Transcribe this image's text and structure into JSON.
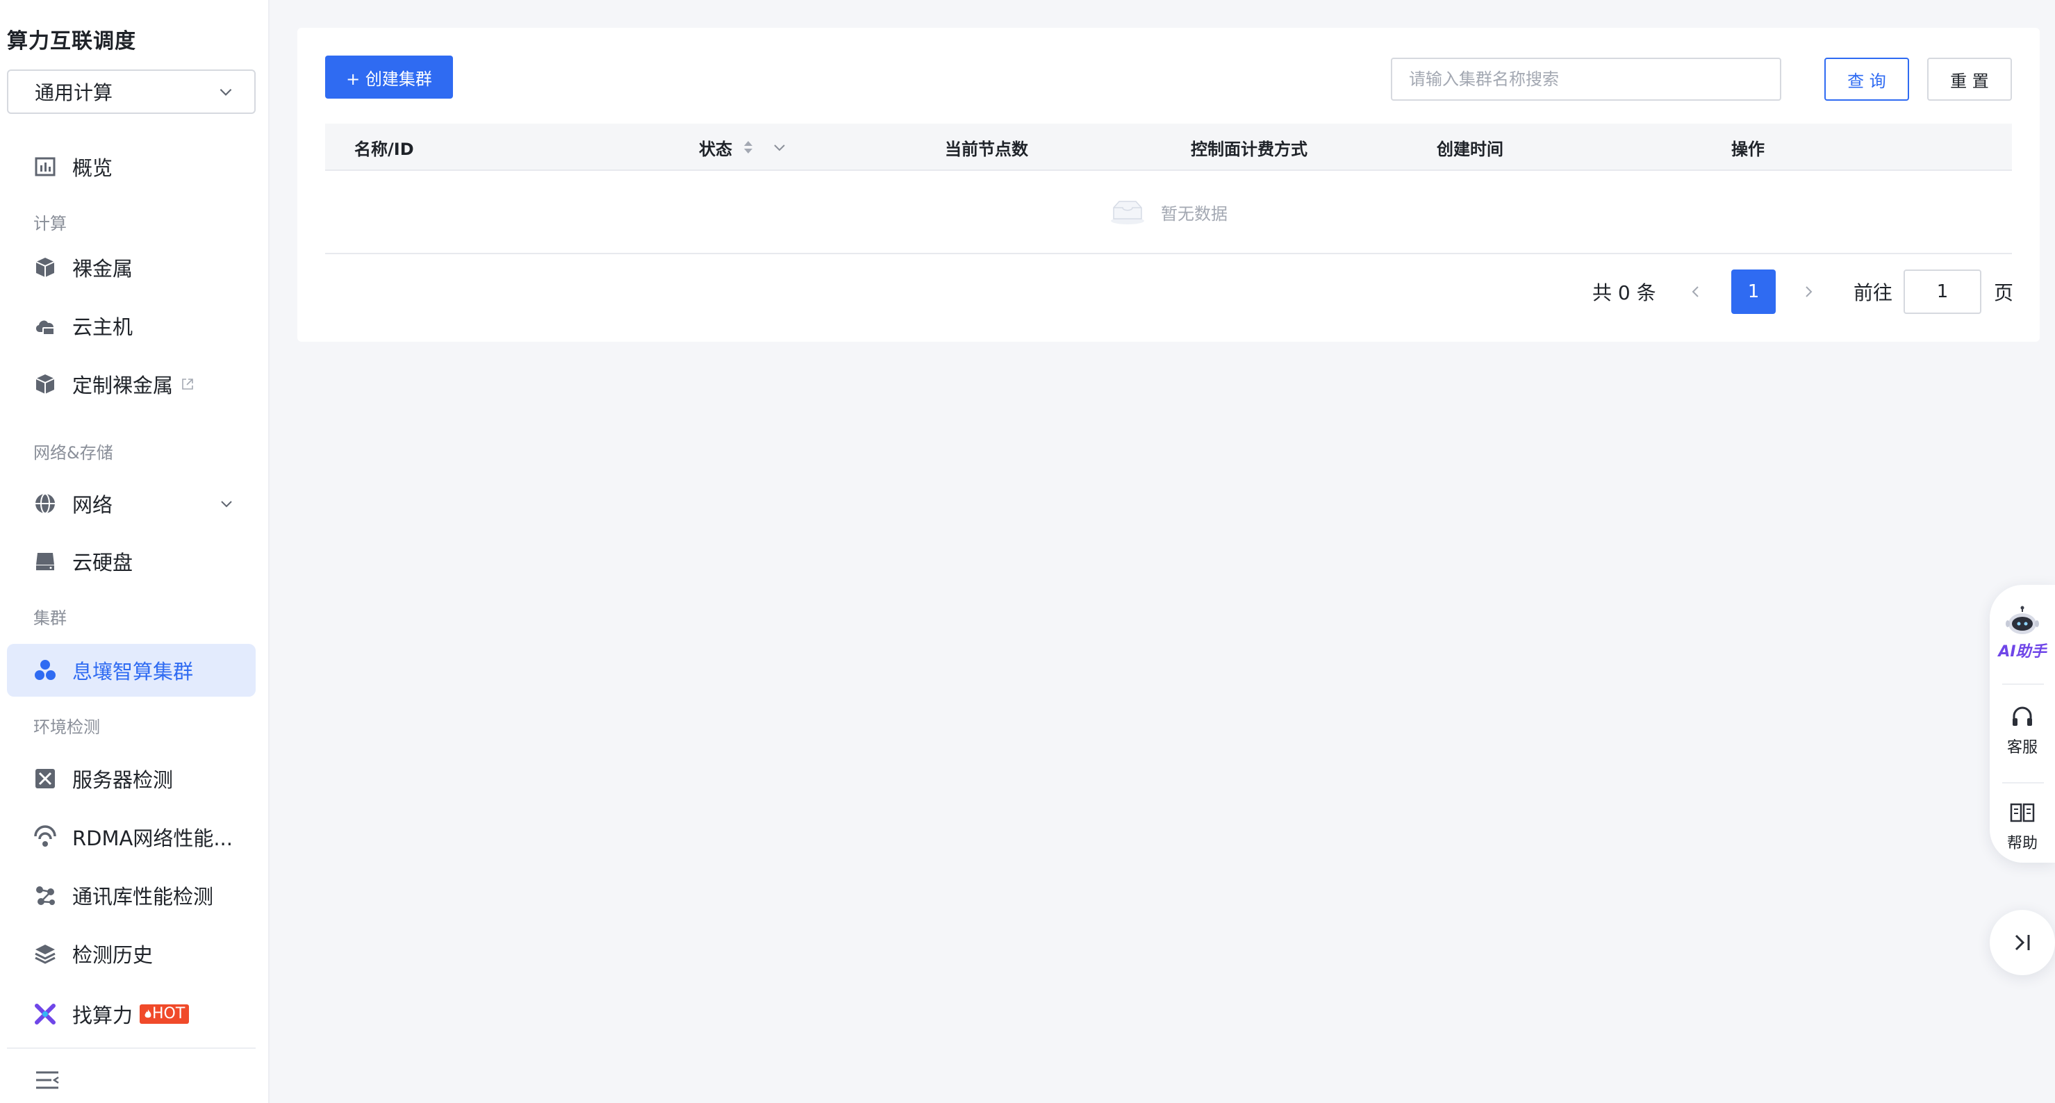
{
  "app": {
    "title": "算力互联调度"
  },
  "product_select": {
    "value": "通用计算"
  },
  "sidebar": {
    "overview": "概览",
    "group_compute": "计算",
    "bare_metal": "裸金属",
    "cloud_host": "云主机",
    "custom_bare_metal": "定制裸金属",
    "group_network_storage": "网络&存储",
    "network": "网络",
    "cloud_disk": "云硬盘",
    "group_cluster": "集群",
    "xirang_cluster": "息壤智算集群",
    "group_env_check": "环境检测",
    "server_check": "服务器检测",
    "rdma_check": "RDMA网络性能...",
    "comm_lib_check": "通讯库性能检测",
    "check_history": "检测历史",
    "find_compute": "找算力",
    "hot_badge": "HOT"
  },
  "toolbar": {
    "create_label": "+ 创建集群",
    "search_placeholder": "请输入集群名称搜索",
    "query_label": "查 询",
    "reset_label": "重 置"
  },
  "table": {
    "columns": [
      "名称/ID",
      "状态",
      "当前节点数",
      "控制面计费方式",
      "创建时间",
      "操作"
    ],
    "empty_text": "暂无数据"
  },
  "pagination": {
    "total_text": "共 0 条",
    "current_page": "1",
    "goto_label": "前往",
    "goto_value": "1",
    "page_suffix": "页"
  },
  "float_panel": {
    "ai_label": "AI助手",
    "service_label": "客服",
    "help_label": "帮助"
  },
  "colors": {
    "primary": "#2f6bf2",
    "active_bg": "#e3ebfd",
    "hot": "#f04a2a",
    "ai_purple": "#6f46e8"
  }
}
